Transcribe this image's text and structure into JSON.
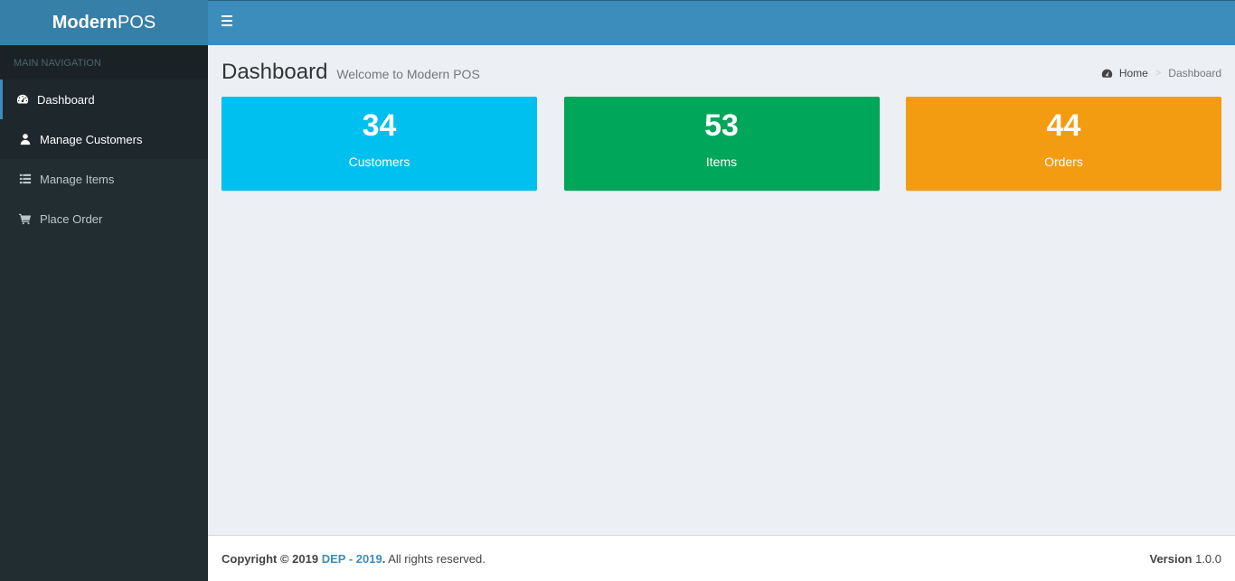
{
  "logo": {
    "bold": "Modern",
    "light": "POS"
  },
  "sidebar": {
    "header": "MAIN NAVIGATION",
    "items": [
      {
        "label": "Dashboard",
        "icon": "dashboard-icon"
      },
      {
        "label": "Manage Customers",
        "icon": "user-icon"
      },
      {
        "label": "Manage Items",
        "icon": "list-icon"
      },
      {
        "label": "Place Order",
        "icon": "cart-icon"
      }
    ]
  },
  "header": {
    "title": "Dashboard",
    "subtitle": "Welcome to Modern POS"
  },
  "breadcrumb": {
    "home": "Home",
    "separator": ">",
    "current": "Dashboard"
  },
  "stats": [
    {
      "value": "34",
      "label": "Customers",
      "color": "#00c0ef"
    },
    {
      "value": "53",
      "label": "Items",
      "color": "#00a65a"
    },
    {
      "value": "44",
      "label": "Orders",
      "color": "#f39c12"
    }
  ],
  "footer": {
    "copyright_prefix": "Copyright © 2019 ",
    "link_part1": "DEP",
    "link_sep": " - ",
    "link_part2": "2019",
    "suffix_bold": ".",
    "suffix": " All rights reserved.",
    "version_label": "Version",
    "version_value": " 1.0.0"
  },
  "colors": {
    "primary": "#3c8dbc",
    "sidebar": "#222d32"
  }
}
